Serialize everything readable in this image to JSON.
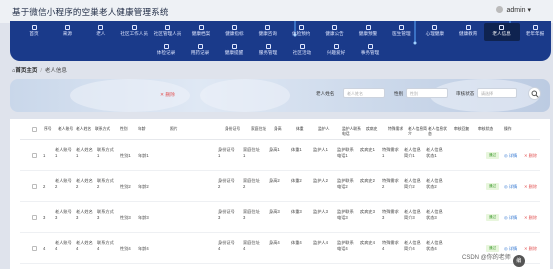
{
  "app": {
    "title": "基于微信小程序的空巢老人健康管理系统",
    "user": "admin ▾"
  },
  "nav": {
    "row1": [
      "首页",
      "来源",
      "老人",
      "社区工作人员",
      "社区管理人员",
      "健康档案",
      "健康指标",
      "健康咨询",
      "体检预约",
      "健康公告",
      "健康预警",
      "医生管理",
      "心理健康",
      "健康教育",
      "老人信息",
      "老年年报"
    ],
    "row2": [
      "体检记录",
      "用药记录",
      "健康提醒",
      "服务管理",
      "社区活动",
      "兴趣爱好",
      "事务管理"
    ],
    "active": "老人信息"
  },
  "breadcrumb": {
    "home": "首页主页",
    "current": "老人信息"
  },
  "search": {
    "delete_label": "✕ 删除",
    "name_label": "老人姓名",
    "name_placeholder": "老人姓名",
    "gender_label": "性别",
    "gender_placeholder": "性别",
    "review_label": "审核状态",
    "review_placeholder": "请选择"
  },
  "table": {
    "headers": [
      "序号",
      "老人账号",
      "老人姓名",
      "联系方式",
      "性别",
      "年龄",
      "照片",
      "身份证号",
      "家庭住址",
      "身高",
      "体重",
      "监护人",
      "监护人联系电话",
      "疾病史",
      "特殊需求",
      "老人信息简介",
      "老人信息状态",
      "审核回复",
      "审核状态",
      "操作"
    ],
    "rows": [
      {
        "no": "1",
        "account": "老人账号1",
        "name": "老人姓名1",
        "phone": "联系方式1",
        "gender": "性别1",
        "age": "年龄1",
        "idno": "身份证号1",
        "address": "家庭住址1",
        "height": "身高1",
        "weight": "体重1",
        "guardian": "监护人1",
        "gphone": "监护联系电话1",
        "disease": "疾病史1",
        "special": "特殊需求1",
        "intro": "老人信息简介1",
        "status": "老人信息状态1",
        "review": "通过"
      },
      {
        "no": "2",
        "account": "老人账号2",
        "name": "老人姓名2",
        "phone": "联系方式2",
        "gender": "性别2",
        "age": "年龄2",
        "idno": "身份证号2",
        "address": "家庭住址2",
        "height": "身高2",
        "weight": "体重2",
        "guardian": "监护人2",
        "gphone": "监护联系电话2",
        "disease": "疾病史2",
        "special": "特殊需求2",
        "intro": "老人信息简介2",
        "status": "老人信息状态2",
        "review": "通过"
      },
      {
        "no": "3",
        "account": "老人账号3",
        "name": "老人姓名3",
        "phone": "联系方式3",
        "gender": "性别3",
        "age": "年龄3",
        "idno": "身份证号3",
        "address": "家庭住址3",
        "height": "身高3",
        "weight": "体重3",
        "guardian": "监护人3",
        "gphone": "监护联系电话3",
        "disease": "疾病史3",
        "special": "特殊需求3",
        "intro": "老人信息简介3",
        "status": "老人信息状态3",
        "review": "通过"
      },
      {
        "no": "4",
        "account": "老人账号4",
        "name": "老人姓名4",
        "phone": "联系方式4",
        "gender": "性别4",
        "age": "年龄4",
        "idno": "身份证号4",
        "address": "家庭住址4",
        "height": "身高4",
        "weight": "体重4",
        "guardian": "监护人4",
        "gphone": "监护联系电话4",
        "disease": "疾病史4",
        "special": "特殊需求4",
        "intro": "老人信息简介4",
        "status": "老人信息状态4",
        "review": "通过"
      }
    ],
    "detail_label": "◎ 详情",
    "delete_label": "✕ 删除"
  },
  "watermark": {
    "text": "CSDN @你的老师",
    "badge": "编"
  },
  "colors": {
    "nav_bg": "#1a3a8a",
    "active_bg": "#0f2350",
    "link": "#2e74d0",
    "danger": "#e25555",
    "ok_bg": "#e8f6dd"
  }
}
